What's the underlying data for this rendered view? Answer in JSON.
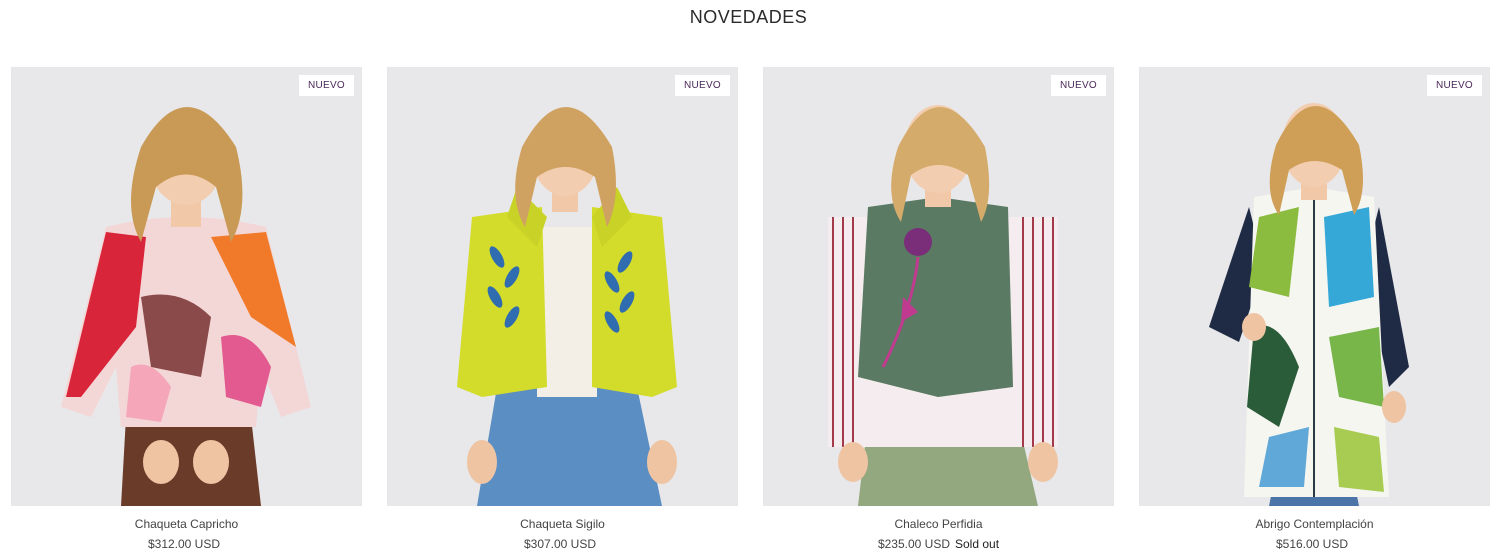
{
  "section": {
    "title": "NOVEDADES"
  },
  "products": [
    {
      "badge": "NUEVO",
      "name": "Chaqueta Capricho",
      "price": "$312.00 USD",
      "status": ""
    },
    {
      "badge": "NUEVO",
      "name": "Chaqueta Sigilo",
      "price": "$307.00 USD",
      "status": ""
    },
    {
      "badge": "NUEVO",
      "name": "Chaleco Perfidia",
      "price": "$235.00 USD",
      "status": "Sold out"
    },
    {
      "badge": "NUEVO",
      "name": "Abrigo Contemplación",
      "price": "$516.00 USD",
      "status": ""
    }
  ],
  "colors": {
    "image_bg": "#e8e8ea",
    "badge_text": "#4a2a5a",
    "text": "#444444"
  }
}
